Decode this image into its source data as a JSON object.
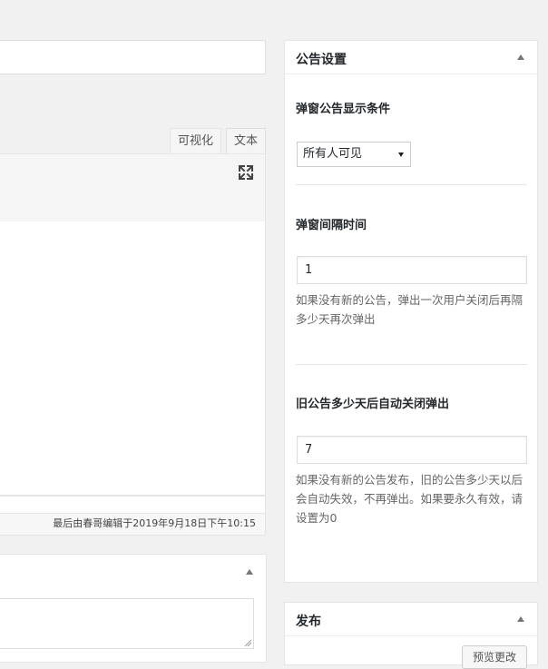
{
  "editor": {
    "tab_visual": "可视化",
    "tab_text": "文本",
    "last_edited": "最后由春哥编辑于2019年9月18日下午10:15"
  },
  "settings": {
    "title": "公告设置",
    "condition_label": "弹窗公告显示条件",
    "condition_value": "所有人可见",
    "interval_label": "弹窗间隔时间",
    "interval_value": "1",
    "interval_help": "如果没有新的公告，弹出一次用户关闭后再隔多少天再次弹出",
    "expire_label": "旧公告多少天后自动关闭弹出",
    "expire_value": "7",
    "expire_help": "如果没有新的公告发布，旧的公告多少天以后会自动失效，不再弹出。如果要永久有效，请设置为0"
  },
  "publish": {
    "title": "发布",
    "preview_label": "预览更改"
  },
  "colors": {
    "background": "#f1f1f1",
    "panel": "#ffffff",
    "border": "#e5e5e5",
    "help_text": "#666666"
  }
}
